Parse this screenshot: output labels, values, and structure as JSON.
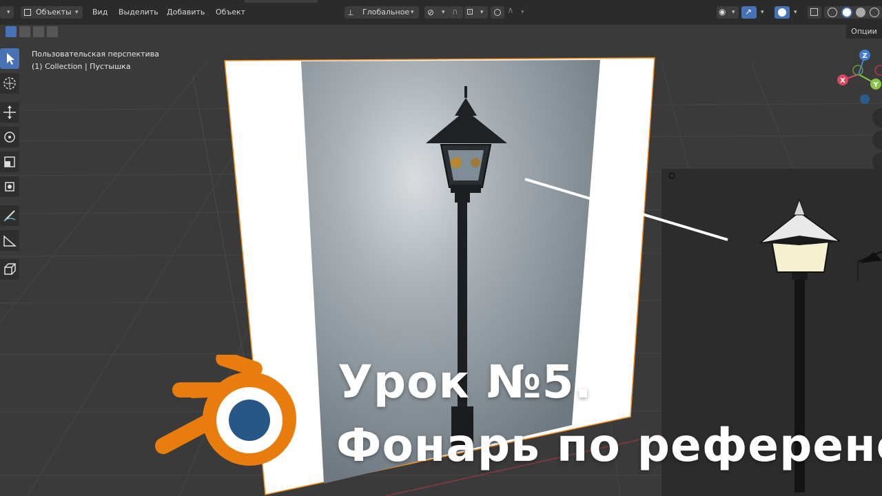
{
  "header": {
    "object_mode": "Объекты",
    "menu": [
      "Вид",
      "Выделить",
      "Добавить",
      "Объект"
    ],
    "orientation": "Глобальное"
  },
  "options_label": "Опции",
  "viewport_info": {
    "view_name": "Пользовательская перспектива",
    "collection_line": "(1) Collection | Пустышка"
  },
  "gizmo": {
    "z": "Z",
    "y": "Y",
    "x": "X"
  },
  "overlay_title": {
    "line1": "Урок №5.",
    "line2": "Фонарь по референсу"
  },
  "colors": {
    "accent": "#4772b3",
    "header_bg": "#2b2b2b",
    "viewport_bg": "#3a3a3a",
    "selection_outline": "#f08a1a",
    "blender_orange": "#e87d0d",
    "blender_blue": "#265787"
  }
}
